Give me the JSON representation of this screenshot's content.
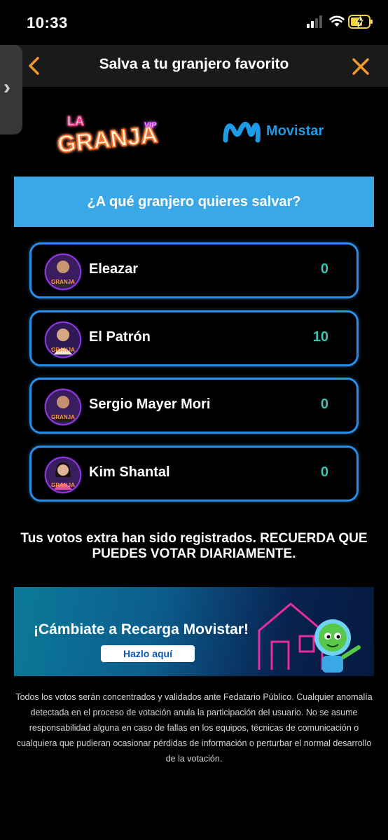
{
  "status_bar": {
    "time": "10:33"
  },
  "header": {
    "title": "Salva a tu granjero favorito"
  },
  "logos": {
    "partner": "Movistar"
  },
  "question": "¿A qué granjero quieres salvar?",
  "candidates": [
    {
      "name": "Eleazar",
      "votes": "0"
    },
    {
      "name": "El Patrón",
      "votes": "10"
    },
    {
      "name": "Sergio Mayer Mori",
      "votes": "0"
    },
    {
      "name": "Kim Shantal",
      "votes": "0"
    }
  ],
  "message": "Tus votos extra han sido registrados. RECUERDA QUE PUEDES VOTAR DIARIAMENTE.",
  "banner": {
    "headline": "¡Cámbiate a Recarga Movistar!",
    "button": "Hazlo aquí"
  },
  "disclaimer": "Todos los votos serán concentrados y validados ante Fedatario Público. Cualquier anomalía detectada en el proceso de votación anula la participación del usuario. No se asume responsabilidad alguna en caso de fallas en los equipos, técnicas de comunicación o cualquiera que pudieran ocasionar pérdidas de información o perturbar el normal desarrollo de la votación.",
  "colors": {
    "accent": "#f0972e",
    "question_bg": "#3aa7e6",
    "card_border": "#2a8ee8",
    "vote_color": "#2fc7b7",
    "brand": "#1b9be8"
  },
  "icons": {
    "back": "chevron-left-icon",
    "close": "close-icon",
    "side": "chevron-right-icon"
  }
}
